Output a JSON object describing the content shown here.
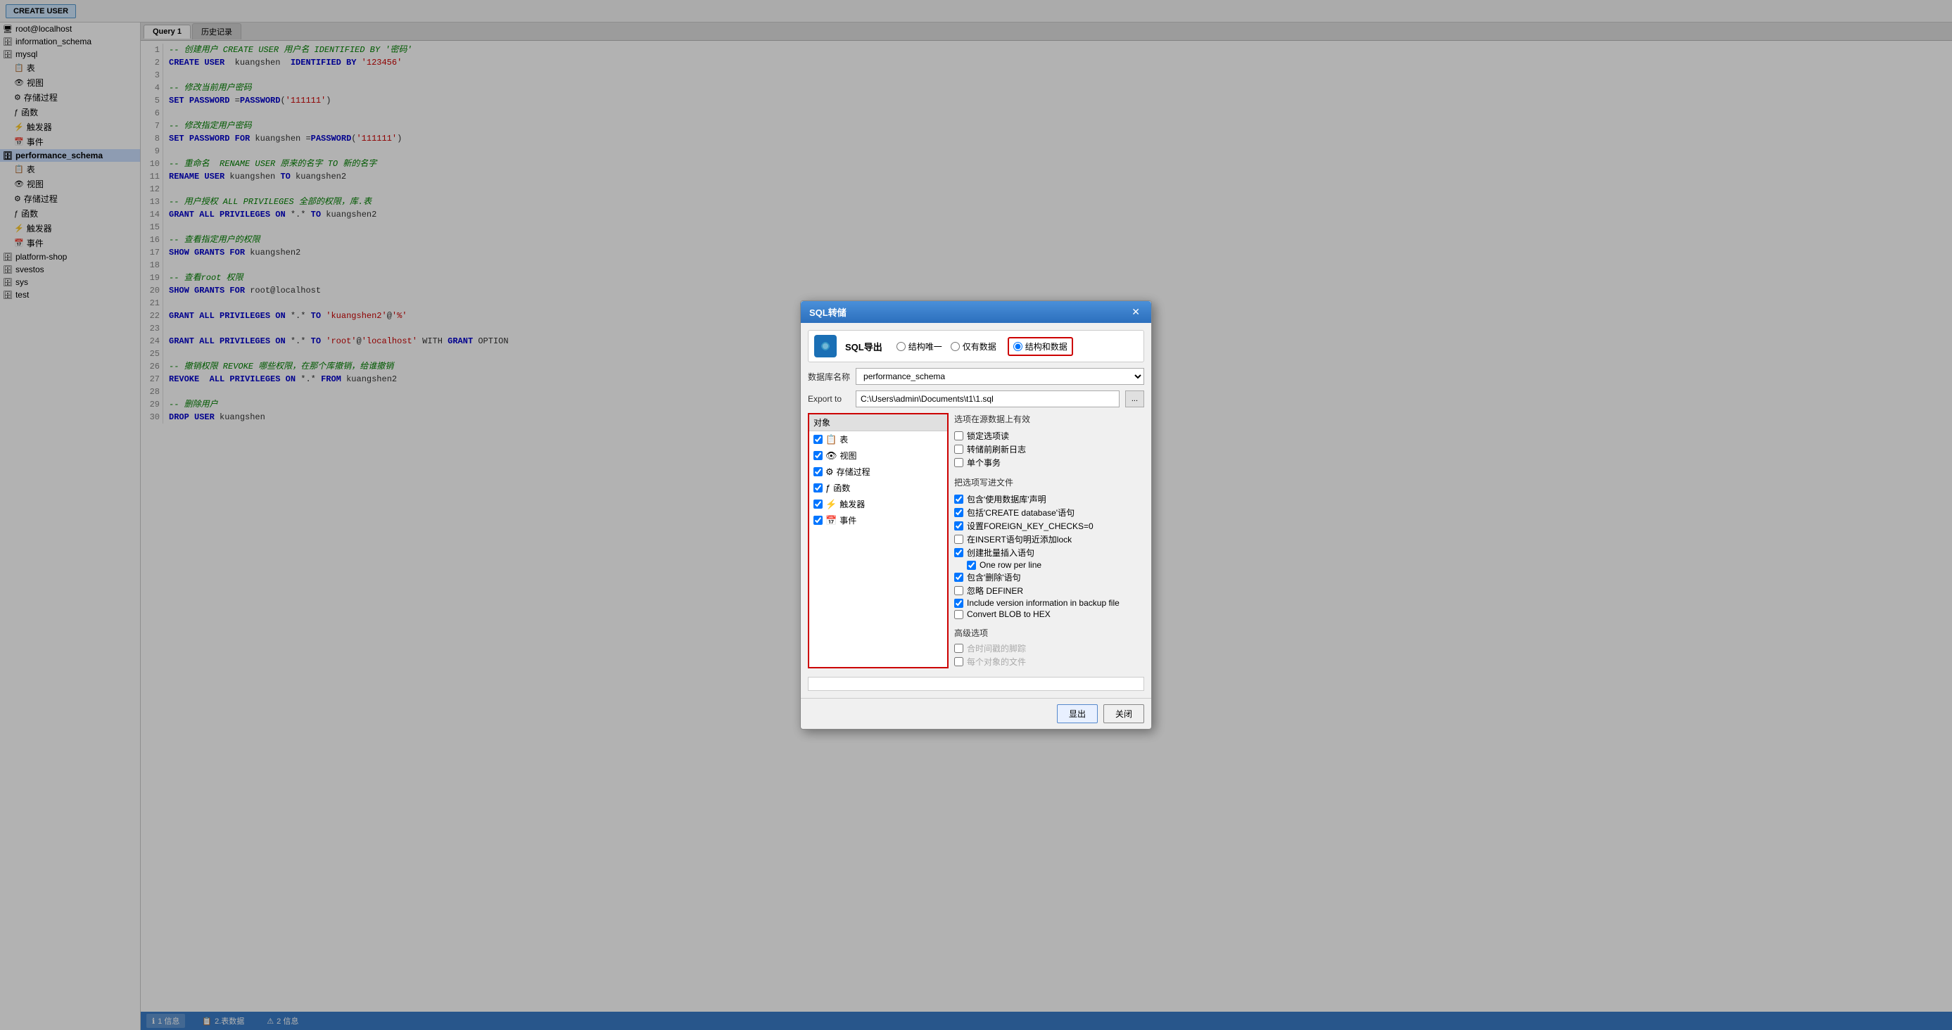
{
  "toolbar": {
    "create_user_label": "CREATE USER"
  },
  "sidebar": {
    "items": [
      {
        "id": "root",
        "label": "root@localhost",
        "level": 0,
        "icon": "🖥",
        "type": "host"
      },
      {
        "id": "info_schema",
        "label": "information_schema",
        "level": 0,
        "icon": "🗄",
        "type": "db"
      },
      {
        "id": "mysql",
        "label": "mysql",
        "level": 0,
        "icon": "🗄",
        "type": "db"
      },
      {
        "id": "mysql_table",
        "label": "表",
        "level": 1,
        "icon": "📋",
        "type": "table"
      },
      {
        "id": "mysql_view",
        "label": "视图",
        "level": 1,
        "icon": "👁",
        "type": "view"
      },
      {
        "id": "mysql_proc",
        "label": "存储过程",
        "level": 1,
        "icon": "⚙",
        "type": "proc"
      },
      {
        "id": "mysql_func",
        "label": "函数",
        "level": 1,
        "icon": "ƒ",
        "type": "func"
      },
      {
        "id": "mysql_trig",
        "label": "触发器",
        "level": 1,
        "icon": "⚡",
        "type": "trigger"
      },
      {
        "id": "mysql_event",
        "label": "事件",
        "level": 1,
        "icon": "📅",
        "type": "event"
      },
      {
        "id": "perf_schema",
        "label": "performance_schema",
        "level": 0,
        "icon": "🗄",
        "type": "db",
        "selected": true
      },
      {
        "id": "perf_table",
        "label": "表",
        "level": 1,
        "icon": "📋",
        "type": "table"
      },
      {
        "id": "perf_view",
        "label": "视图",
        "level": 1,
        "icon": "👁",
        "type": "view"
      },
      {
        "id": "perf_proc",
        "label": "存储过程",
        "level": 1,
        "icon": "⚙",
        "type": "proc"
      },
      {
        "id": "perf_func",
        "label": "函数",
        "level": 1,
        "icon": "ƒ",
        "type": "func"
      },
      {
        "id": "perf_trig",
        "label": "触发器",
        "level": 1,
        "icon": "⚡",
        "type": "trigger"
      },
      {
        "id": "perf_event",
        "label": "事件",
        "level": 1,
        "icon": "📅",
        "type": "event"
      },
      {
        "id": "platform_shop",
        "label": "platform-shop",
        "level": 0,
        "icon": "🗄",
        "type": "db"
      },
      {
        "id": "svesros",
        "label": "svestos",
        "level": 0,
        "icon": "🗄",
        "type": "db"
      },
      {
        "id": "sys",
        "label": "sys",
        "level": 0,
        "icon": "🗄",
        "type": "db"
      },
      {
        "id": "test",
        "label": "test",
        "level": 0,
        "icon": "🗄",
        "type": "db"
      }
    ]
  },
  "editor": {
    "tab_label": "Query 1",
    "tab2_label": "历史记录",
    "lines": [
      {
        "num": 1,
        "code": "-- 创建用户 CREATE USER 用户名 IDENTIFIED BY '密码'",
        "type": "comment"
      },
      {
        "num": 2,
        "code": "CREATE USER  kuangshen  IDENTIFIED BY '123456'",
        "type": "code"
      },
      {
        "num": 3,
        "code": "",
        "type": "empty"
      },
      {
        "num": 4,
        "code": "-- 修改当前用户密码",
        "type": "comment"
      },
      {
        "num": 5,
        "code": "SET PASSWORD =PASSWORD('111111')",
        "type": "code"
      },
      {
        "num": 6,
        "code": "",
        "type": "empty"
      },
      {
        "num": 7,
        "code": "-- 修改指定用户密码",
        "type": "comment"
      },
      {
        "num": 8,
        "code": "SET PASSWORD FOR kuangshen =PASSWORD('111111')",
        "type": "code"
      },
      {
        "num": 9,
        "code": "",
        "type": "empty"
      },
      {
        "num": 10,
        "code": "-- 重命名  RENAME USER 原来的名字 TO 新的名字",
        "type": "comment"
      },
      {
        "num": 11,
        "code": "RENAME USER kuangshen TO kuangshen2",
        "type": "code"
      },
      {
        "num": 12,
        "code": "",
        "type": "empty"
      },
      {
        "num": 13,
        "code": "-- 用户授权 ALL PRIVILEGES 全部的权限，库.表",
        "type": "comment"
      },
      {
        "num": 14,
        "code": "GRANT ALL PRIVILEGES ON *.* TO kuangshen2",
        "type": "code"
      },
      {
        "num": 15,
        "code": "",
        "type": "empty"
      },
      {
        "num": 16,
        "code": "-- 查看指定用户的权限",
        "type": "comment"
      },
      {
        "num": 17,
        "code": "SHOW GRANTS FOR kuangshen2",
        "type": "code"
      },
      {
        "num": 18,
        "code": "",
        "type": "empty"
      },
      {
        "num": 19,
        "code": "-- 查看root 权限",
        "type": "comment"
      },
      {
        "num": 20,
        "code": "SHOW GRANTS FOR root@localhost",
        "type": "code"
      },
      {
        "num": 21,
        "code": "",
        "type": "empty"
      },
      {
        "num": 22,
        "code": "GRANT ALL PRIVILEGES ON *.* TO 'kuangshen2'@'%'",
        "type": "code"
      },
      {
        "num": 23,
        "code": "",
        "type": "empty"
      },
      {
        "num": 24,
        "code": "GRANT ALL PRIVILEGES ON *.* TO 'root'@'localhost' WITH GRANT OPTION",
        "type": "code"
      },
      {
        "num": 25,
        "code": "",
        "type": "empty"
      },
      {
        "num": 26,
        "code": "-- 撤销权限 REVOKE 哪些权限，在那个库撤销，给谁撤销",
        "type": "comment"
      },
      {
        "num": 27,
        "code": "REVOKE  ALL PRIVILEGES ON *.* FROM kuangshen2",
        "type": "code"
      },
      {
        "num": 28,
        "code": "",
        "type": "empty"
      },
      {
        "num": 29,
        "code": "-- 删除用户",
        "type": "comment"
      },
      {
        "num": 30,
        "code": "DROP USER kuangshen",
        "type": "code"
      }
    ]
  },
  "bottom_tabs": [
    {
      "id": "info",
      "label": "1 信息",
      "icon": "ℹ",
      "active": true
    },
    {
      "id": "tabledata",
      "label": "2.表数据",
      "icon": "📋",
      "active": false
    },
    {
      "id": "info2",
      "label": "2 信息",
      "icon": "⚠",
      "active": false
    }
  ],
  "dialog": {
    "title": "SQL转储",
    "close_label": "✕",
    "sql_export_label": "SQL导出",
    "radio_options": [
      {
        "id": "structure_only",
        "label": "结构唯一",
        "checked": false
      },
      {
        "id": "data_only",
        "label": "仅有数据",
        "checked": false
      },
      {
        "id": "structure_and_data",
        "label": "结构和数据",
        "checked": true
      }
    ],
    "db_label": "数据库名称",
    "db_value": "performance_schema",
    "export_to_label": "Export to",
    "export_path": "C:\\Users\\admin\\Documents\\t1\\1.sql",
    "browse_label": "...",
    "objects_label": "对象",
    "objects": [
      {
        "label": "表",
        "checked": true,
        "icon": "📋"
      },
      {
        "label": "视图",
        "checked": true,
        "icon": "👁"
      },
      {
        "label": "存储过程",
        "checked": true,
        "icon": "⚙"
      },
      {
        "label": "函数",
        "checked": true,
        "icon": "ƒ"
      },
      {
        "label": "触发器",
        "checked": true,
        "icon": "⚡"
      },
      {
        "label": "事件",
        "checked": true,
        "icon": "📅"
      }
    ],
    "options_title": "选项在源数据上有效",
    "options": [
      {
        "label": "锁定选项读",
        "checked": false,
        "indent": 0
      },
      {
        "label": "转储前刷新日志",
        "checked": false,
        "indent": 0
      },
      {
        "label": "单个事务",
        "checked": false,
        "indent": 0
      }
    ],
    "write_options_title": "把选项写进文件",
    "write_options": [
      {
        "label": "包含'使用数据库'声明",
        "checked": true,
        "indent": 0
      },
      {
        "label": "包括'CREATE database'语句",
        "checked": true,
        "indent": 0
      },
      {
        "label": "设置FOREIGN_KEY_CHECKS=0",
        "checked": true,
        "indent": 0
      },
      {
        "label": "在INSERT语句明近添加lock",
        "checked": false,
        "indent": 0
      },
      {
        "label": "创建批量插入语句",
        "checked": true,
        "indent": 0
      },
      {
        "label": "One row per line",
        "checked": true,
        "indent": 1
      },
      {
        "label": "包含'删除'语句",
        "checked": true,
        "indent": 0
      },
      {
        "label": "忽略 DEFINER",
        "checked": false,
        "indent": 0
      },
      {
        "label": "Include version information in backup file",
        "checked": true,
        "indent": 0
      },
      {
        "label": "Convert BLOB to HEX",
        "checked": false,
        "indent": 0
      }
    ],
    "advanced_title": "高级选项",
    "advanced_options": [
      {
        "label": "合时间戳的脚踪",
        "checked": false
      },
      {
        "label": "每个对象的文件",
        "checked": false
      }
    ],
    "export_btn": "显出",
    "close_btn": "关闭"
  }
}
